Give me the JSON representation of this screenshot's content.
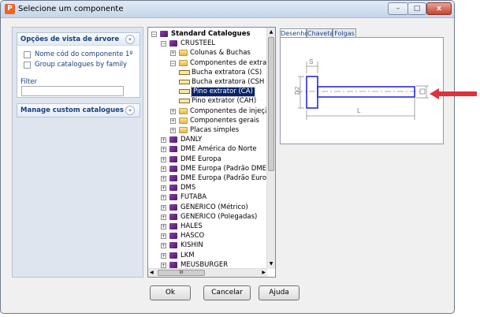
{
  "window": {
    "title": "Selecione um componente",
    "app_icon_letter": "P",
    "minimize_glyph": "–",
    "maximize_glyph": "□",
    "close_glyph": "x"
  },
  "left_panel": {
    "view_options": {
      "title": "Opções de vista de árvore",
      "collapse_glyph": "«",
      "checkboxes": [
        {
          "label": "Nome cód do componente 1º",
          "checked": false
        },
        {
          "label": "Group catalogues by family",
          "checked": false
        }
      ],
      "filter_label": "Filter",
      "filter_value": ""
    },
    "custom_catalogues": {
      "title": "Manage custom catalogues",
      "expand_glyph": "»"
    }
  },
  "tree": {
    "items": [
      {
        "label": "Standard Catalogues",
        "icon": "book-icon",
        "expander": "−",
        "bold": true
      },
      {
        "label": "CRUSTEEL",
        "icon": "book-icon",
        "expander": "−"
      },
      {
        "label": "Colunas & Buchas",
        "icon": "folder-icon",
        "expander": "+"
      },
      {
        "label": "Componentes de extraçã",
        "icon": "folder-icon",
        "expander": "−"
      },
      {
        "label": "Bucha extratora (CS)",
        "icon": "pin-icon",
        "expander": ""
      },
      {
        "label": "Bucha extratora (CSH",
        "icon": "pin-icon",
        "expander": ""
      },
      {
        "label": "Pino extrator (CA)",
        "icon": "pin-icon",
        "expander": "",
        "selected": true
      },
      {
        "label": "Pino extrator (CAH)",
        "icon": "pin-icon",
        "expander": ""
      },
      {
        "label": "Componentes de injeção",
        "icon": "folder-icon",
        "expander": "+"
      },
      {
        "label": "Componentes gerais",
        "icon": "folder-icon",
        "expander": "+"
      },
      {
        "label": "Placas simples",
        "icon": "folder-icon",
        "expander": "+"
      },
      {
        "label": "DANLY",
        "icon": "book-icon",
        "expander": "+"
      },
      {
        "label": "DME América do Norte",
        "icon": "book-icon",
        "expander": "+"
      },
      {
        "label": "DME Europa",
        "icon": "book-icon",
        "expander": "+"
      },
      {
        "label": "DME Europa (Padrão DME)",
        "icon": "book-icon",
        "expander": "+"
      },
      {
        "label": "DME Europa (Padrão Europe",
        "icon": "book-icon",
        "expander": "+"
      },
      {
        "label": "DMS",
        "icon": "book-icon",
        "expander": "+"
      },
      {
        "label": "FUTABA",
        "icon": "book-icon",
        "expander": "+"
      },
      {
        "label": "GENERICO (Métrico)",
        "icon": "book-icon",
        "expander": "+"
      },
      {
        "label": "GENERICO (Polegadas)",
        "icon": "book-icon",
        "expander": "+"
      },
      {
        "label": "HALES",
        "icon": "book-icon",
        "expander": "+"
      },
      {
        "label": "HASCO",
        "icon": "book-icon",
        "expander": "+"
      },
      {
        "label": "KISHIN",
        "icon": "book-icon",
        "expander": "+"
      },
      {
        "label": "LKM",
        "icon": "book-icon",
        "expander": "+"
      },
      {
        "label": "MEUSBURGER",
        "icon": "book-icon",
        "expander": "+"
      }
    ],
    "hscroll_label": "III"
  },
  "preview": {
    "tabs": [
      {
        "label": "Desenho",
        "active": true
      },
      {
        "label": "Chaveta",
        "active": false
      },
      {
        "label": "Folgas",
        "active": false
      }
    ],
    "dimension_labels": {
      "s": "S",
      "d2": "D2",
      "l": "L",
      "d": "D"
    },
    "colors": {
      "part_outline": "#2a2ad8",
      "dimension": "#909090",
      "arrow": "#e0313a"
    }
  },
  "buttons": {
    "ok": "Ok",
    "cancel": "Cancelar",
    "help": "Ajuda"
  }
}
